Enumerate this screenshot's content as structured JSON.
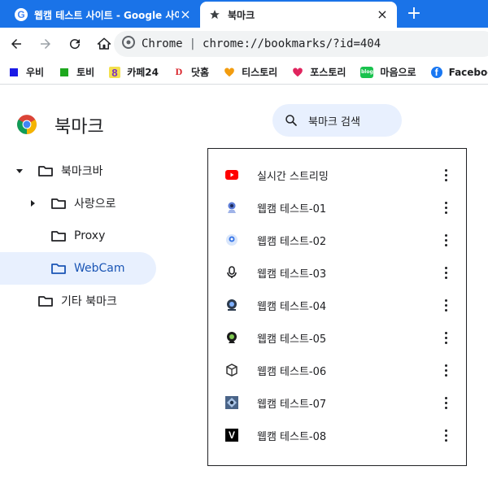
{
  "tabs": [
    {
      "title": "웹캠 테스트 사이트 - Google 사이트",
      "close": "×"
    },
    {
      "title": "북마크",
      "close": "×"
    }
  ],
  "new_tab": "+",
  "omnibox": {
    "site": "Chrome",
    "separator": "|",
    "url": "chrome://bookmarks/?id=404"
  },
  "bookmarks_bar": [
    {
      "label": "우비",
      "icon": "blue-square-icon",
      "color": "#1a1ae6"
    },
    {
      "label": "토비",
      "icon": "green-square-icon",
      "color": "#1ea81e"
    },
    {
      "label": "카페24",
      "icon": "cafe24-icon",
      "color": "#7b2fbf"
    },
    {
      "label": "닷홈",
      "icon": "dothome-icon",
      "glyph": "D",
      "color": "#d81f26"
    },
    {
      "label": "티스토리",
      "icon": "heart-icon",
      "color": "#f29c0f"
    },
    {
      "label": "포스토리",
      "icon": "heart-ribbon-icon",
      "color": "#e0245e"
    },
    {
      "label": "마음으로",
      "icon": "blog-icon",
      "glyph": "blog",
      "color": "#19c24e"
    },
    {
      "label": "Facebook",
      "icon": "facebook-icon",
      "glyph": "f",
      "color": "#1877f2"
    }
  ],
  "page": {
    "title": "북마크",
    "search_placeholder": "북마크 검색"
  },
  "tree": [
    {
      "label": "북마크바",
      "expanded": true
    },
    {
      "label": "사랑으로",
      "collapsed": true
    },
    {
      "label": "Proxy"
    },
    {
      "label": "WebCam",
      "selected": true
    },
    {
      "label": "기타 북마크"
    }
  ],
  "list": [
    {
      "label": "실시간 스트리밍",
      "icon": "youtube-icon"
    },
    {
      "label": "웹캠 테스트-01",
      "icon": "webcam-1-icon"
    },
    {
      "label": "웹캠 테스트-02",
      "icon": "webcam-2-icon"
    },
    {
      "label": "웹캠 테스트-03",
      "icon": "microphone-icon"
    },
    {
      "label": "웹캠 테스트-04",
      "icon": "webcam-4-icon"
    },
    {
      "label": "웹캠 테스트-05",
      "icon": "webcam-5-icon"
    },
    {
      "label": "웹캠 테스트-06",
      "icon": "webcam-6-icon"
    },
    {
      "label": "웹캠 테스트-07",
      "icon": "webcam-7-icon"
    },
    {
      "label": "웹캠 테스트-08",
      "icon": "v-icon",
      "glyph": "V"
    }
  ],
  "colors": {
    "accent": "#1a73e8",
    "selected_bg": "#e8f0fe",
    "selected_text": "#1a55b5"
  }
}
